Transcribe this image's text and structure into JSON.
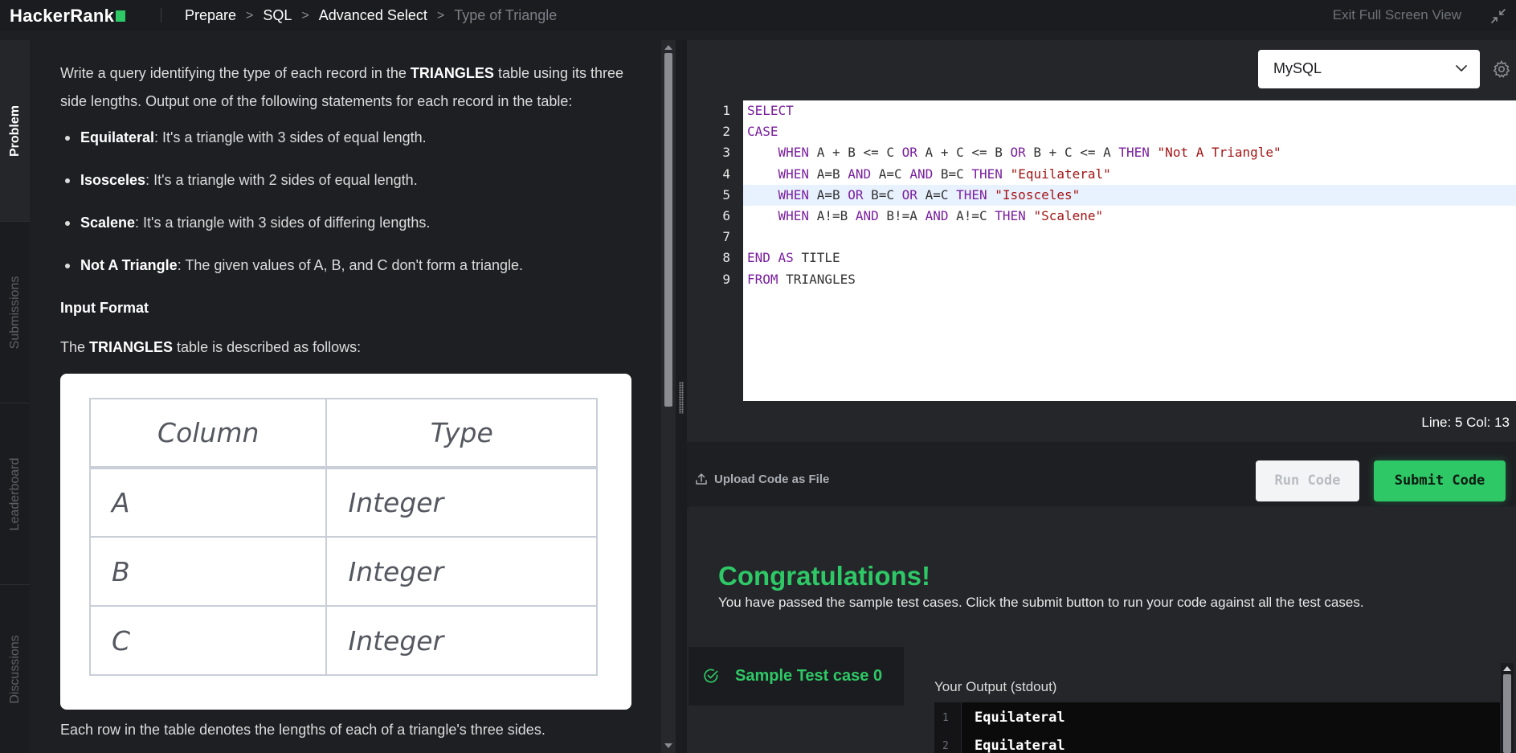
{
  "header": {
    "logo_text": "HackerRank",
    "breadcrumb": [
      "Prepare",
      "SQL",
      "Advanced Select"
    ],
    "current_page": "Type of Triangle",
    "exit_fullscreen": "Exit Full Screen View"
  },
  "side_tabs": [
    "Problem",
    "Submissions",
    "Leaderboard",
    "Discussions"
  ],
  "problem": {
    "intro_1": "Write a query identifying the type of each record in the ",
    "intro_table": "TRIANGLES",
    "intro_2": " table using its three side lengths. Output one of the following statements for each record in the table:",
    "bullets": [
      {
        "term": "Equilateral",
        "text": ": It's a triangle with 3 sides of equal length."
      },
      {
        "term": "Isosceles",
        "text": ": It's a triangle with 2 sides of equal length."
      },
      {
        "term": "Scalene",
        "text": ": It's a triangle with 3 sides of differing lengths."
      },
      {
        "term": "Not A Triangle",
        "text": ": The given values of A, B, and C don't form a triangle."
      }
    ],
    "input_format_heading": "Input Format",
    "table_desc_1": "The ",
    "table_desc_table": "TRIANGLES",
    "table_desc_2": " table is described as follows:",
    "schema": {
      "headers": [
        "Column",
        "Type"
      ],
      "rows": [
        [
          "A",
          "Integer"
        ],
        [
          "B",
          "Integer"
        ],
        [
          "C",
          "Integer"
        ]
      ]
    },
    "after_table": "Each row in the table denotes the lengths of each of a triangle's three sides."
  },
  "editor": {
    "language": "MySQL",
    "line_numbers": [
      "1",
      "2",
      "3",
      "4",
      "5",
      "6",
      "7",
      "8",
      "9"
    ],
    "active_line": 5,
    "code_lines": [
      "SELECT",
      "CASE",
      "    WHEN A + B <= C OR A + C <= B OR B + C <= A THEN \"Not A Triangle\"",
      "    WHEN A=B AND A=C AND B=C THEN \"Equilateral\"",
      "    WHEN A=B OR B=C OR A=C THEN \"Isosceles\"",
      "    WHEN A!=B AND B!=A AND A!=C THEN \"Scalene\"",
      "",
      "END AS TITLE",
      "FROM TRIANGLES"
    ],
    "cursor_position": "Line: 5 Col: 13"
  },
  "actions": {
    "upload_label": "Upload Code as File",
    "run_label": "Run Code",
    "submit_label": "Submit Code"
  },
  "results": {
    "heading": "Congratulations!",
    "message": "You have passed the sample test cases. Click the submit button to run your code against all the test cases.",
    "test_case_label": "Sample Test case 0",
    "output_label": "Your Output (stdout)",
    "output_line_numbers": [
      "1",
      "2"
    ],
    "output_lines": [
      "Equilateral",
      "Equilateral"
    ]
  },
  "colors": {
    "brand_green": "#2ec866",
    "background": "#1e1f23",
    "keyword": "#7a1f9f",
    "string": "#a31515"
  }
}
